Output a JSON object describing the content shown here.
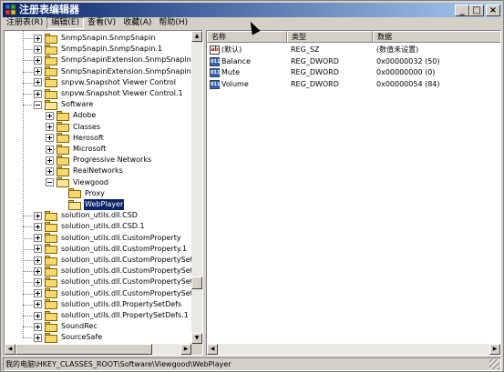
{
  "window": {
    "title": "注册表编辑器",
    "app_icon": "regedit-icon",
    "controls": {
      "minimize": "_",
      "maximize": "□",
      "close": "×"
    }
  },
  "menu": [
    {
      "label": "注册表(R)",
      "active": false
    },
    {
      "label": "编辑(E)",
      "active": true
    },
    {
      "label": "查看(V)",
      "active": false
    },
    {
      "label": "收藏(A)",
      "active": false
    },
    {
      "label": "帮助(H)",
      "active": false
    }
  ],
  "tree": {
    "items": [
      {
        "label": "SnmpSnapin.SnmpSnapin",
        "level": 0,
        "toggle": "plus",
        "open": false,
        "selected": false
      },
      {
        "label": "SnmpSnapin.SnmpSnapin.1",
        "level": 0,
        "toggle": "plus",
        "open": false,
        "selected": false
      },
      {
        "label": "SnmpSnapinExtension.SnmpSnapinExten",
        "level": 0,
        "toggle": "plus",
        "open": false,
        "selected": false
      },
      {
        "label": "SnmpSnapinExtension.SnmpSnapinExten",
        "level": 0,
        "toggle": "plus",
        "open": false,
        "selected": false
      },
      {
        "label": "snpvw.Snapshot Viewer Control",
        "level": 0,
        "toggle": "plus",
        "open": false,
        "selected": false
      },
      {
        "label": "snpvw.Snapshot Viewer Control.1",
        "level": 0,
        "toggle": "plus",
        "open": false,
        "selected": false
      },
      {
        "label": "Software",
        "level": 0,
        "toggle": "minus",
        "open": true,
        "selected": false
      },
      {
        "label": "Adobe",
        "level": 1,
        "toggle": "plus",
        "open": false,
        "selected": false
      },
      {
        "label": "Classes",
        "level": 1,
        "toggle": "plus",
        "open": false,
        "selected": false
      },
      {
        "label": "Herosoft",
        "level": 1,
        "toggle": "plus",
        "open": false,
        "selected": false
      },
      {
        "label": "Microsoft",
        "level": 1,
        "toggle": "plus",
        "open": false,
        "selected": false
      },
      {
        "label": "Progressive Networks",
        "level": 1,
        "toggle": "plus",
        "open": false,
        "selected": false
      },
      {
        "label": "RealNetworks",
        "level": 1,
        "toggle": "plus",
        "open": false,
        "selected": false
      },
      {
        "label": "Viewgood",
        "level": 1,
        "toggle": "minus",
        "open": true,
        "selected": false
      },
      {
        "label": "Proxy",
        "level": 2,
        "toggle": "none",
        "open": false,
        "selected": false
      },
      {
        "label": "WebPlayer",
        "level": 2,
        "toggle": "none",
        "open": true,
        "selected": true
      },
      {
        "label": "solution_utils.dll.CSD",
        "level": 0,
        "toggle": "plus",
        "open": false,
        "selected": false
      },
      {
        "label": "solution_utils.dll.CSD.1",
        "level": 0,
        "toggle": "plus",
        "open": false,
        "selected": false
      },
      {
        "label": "solution_utils.dll.CustomProperty",
        "level": 0,
        "toggle": "plus",
        "open": false,
        "selected": false
      },
      {
        "label": "solution_utils.dll.CustomProperty.1",
        "level": 0,
        "toggle": "plus",
        "open": false,
        "selected": false
      },
      {
        "label": "solution_utils.dll.CustomPropertySet",
        "level": 0,
        "toggle": "plus",
        "open": false,
        "selected": false
      },
      {
        "label": "solution_utils.dll.CustomPropertySet.1",
        "level": 0,
        "toggle": "plus",
        "open": false,
        "selected": false
      },
      {
        "label": "solution_utils.dll.CustomPropertySets",
        "level": 0,
        "toggle": "plus",
        "open": false,
        "selected": false
      },
      {
        "label": "solution_utils.dll.CustomPropertySets.1",
        "level": 0,
        "toggle": "plus",
        "open": false,
        "selected": false
      },
      {
        "label": "solution_utils.dll.PropertySetDefs",
        "level": 0,
        "toggle": "plus",
        "open": false,
        "selected": false
      },
      {
        "label": "solution_utils.dll.PropertySetDefs.1",
        "level": 0,
        "toggle": "plus",
        "open": false,
        "selected": false
      },
      {
        "label": "SoundRec",
        "level": 0,
        "toggle": "plus",
        "open": false,
        "selected": false
      },
      {
        "label": "SourceSafe",
        "level": 0,
        "toggle": "plus",
        "open": false,
        "selected": false
      }
    ]
  },
  "values": {
    "columns": [
      "名称",
      "类型",
      "数据"
    ],
    "rows": [
      {
        "icon": "ab",
        "icon_name": "string-value-icon",
        "name": "(默认)",
        "type": "REG_SZ",
        "data": "(数值未设置)"
      },
      {
        "icon": "011",
        "icon_name": "binary-value-icon",
        "name": "Balance",
        "type": "REG_DWORD",
        "data": "0x00000032 (50)"
      },
      {
        "icon": "011",
        "icon_name": "binary-value-icon",
        "name": "Mute",
        "type": "REG_DWORD",
        "data": "0x00000000 (0)"
      },
      {
        "icon": "011",
        "icon_name": "binary-value-icon",
        "name": "Volume",
        "type": "REG_DWORD",
        "data": "0x00000054 (84)"
      }
    ]
  },
  "scroll": {
    "up": "▲",
    "down": "▼",
    "left": "◀",
    "right": "▶"
  },
  "status": {
    "path": "我的电脑\\HKEY_CLASSES_ROOT\\Software\\Viewgood\\WebPlayer"
  }
}
